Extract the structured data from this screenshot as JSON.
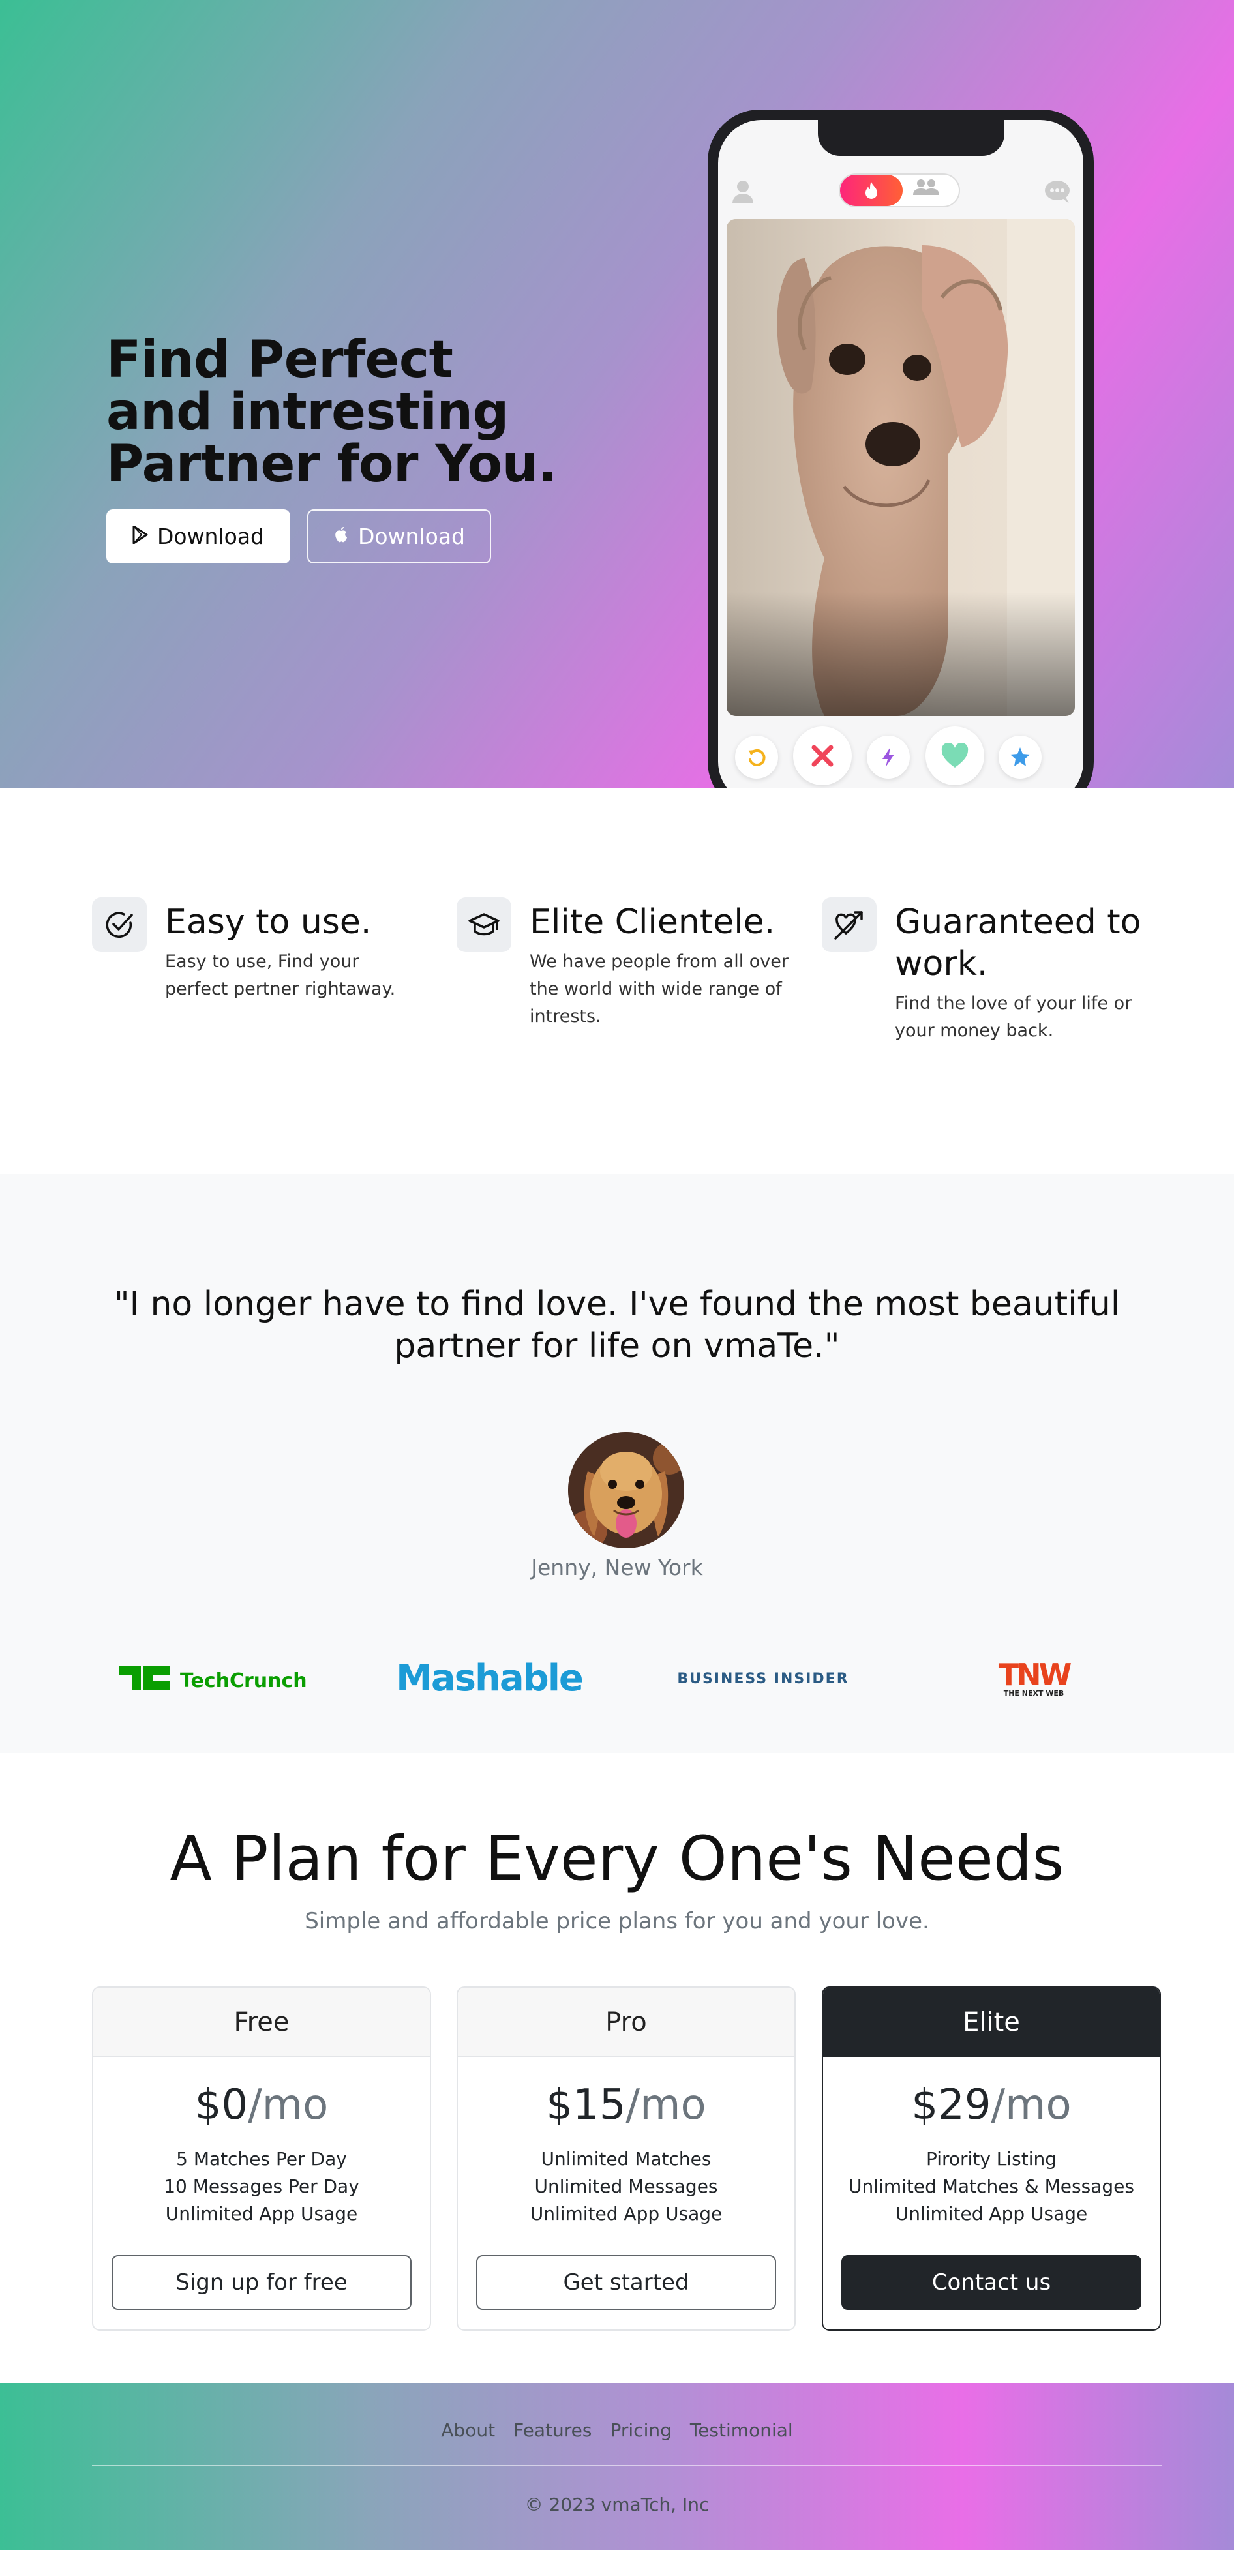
{
  "hero": {
    "title": "Find Perfect and intresting Partner for You.",
    "btn_play": "Download",
    "btn_apple": "Download"
  },
  "features": [
    {
      "icon": "check-circle-icon",
      "title": "Easy to use.",
      "desc": "Easy to use, Find your perfect pertner rightaway."
    },
    {
      "icon": "mortarboard-icon",
      "title": "Elite Clientele.",
      "desc": "We have people from all over the world with wide range of intrests."
    },
    {
      "icon": "heart-arrow-icon",
      "title": "Guaranteed to work.",
      "desc": "Find the love of your life or your money back."
    }
  ],
  "testimonial": {
    "quote": "\"I no longer have to find love. I've found the most beautiful partner for life on vmaTe.\"",
    "author": "Jenny, New York",
    "logos": [
      {
        "name": "TechCrunch",
        "color": "#0a9e01"
      },
      {
        "name": "Mashable",
        "color": "#1c9bd6"
      },
      {
        "name": "BUSINESS INSIDER",
        "color": "#2b5b84"
      },
      {
        "name": "TNW",
        "sub": "THE NEXT WEB",
        "color": "#e8431d"
      }
    ]
  },
  "pricing": {
    "title": "A Plan for Every One's Needs",
    "subtitle": "Simple and affordable price plans for you and your love.",
    "plans": [
      {
        "name": "Free",
        "price": "$0",
        "per": "/mo",
        "features": [
          "5 Matches Per Day",
          "10 Messages Per Day",
          "Unlimited App Usage"
        ],
        "button": "Sign up for free"
      },
      {
        "name": "Pro",
        "price": "$15",
        "per": "/mo",
        "features": [
          "Unlimited Matches",
          "Unlimited Messages",
          "Unlimited App Usage"
        ],
        "button": "Get started"
      },
      {
        "name": "Elite",
        "price": "$29",
        "per": "/mo",
        "features": [
          "Pirority Listing",
          "Unlimited Matches & Messages",
          "Unlimited App Usage"
        ],
        "button": "Contact us"
      }
    ]
  },
  "footer": {
    "links": [
      "About",
      "Features",
      "Pricing",
      "Testimonial"
    ],
    "copyright": "© 2023 vmaTch, Inc"
  },
  "colors": {
    "accent_pink": "#e96ee7",
    "accent_green": "#3bbf94",
    "dark": "#212529"
  }
}
